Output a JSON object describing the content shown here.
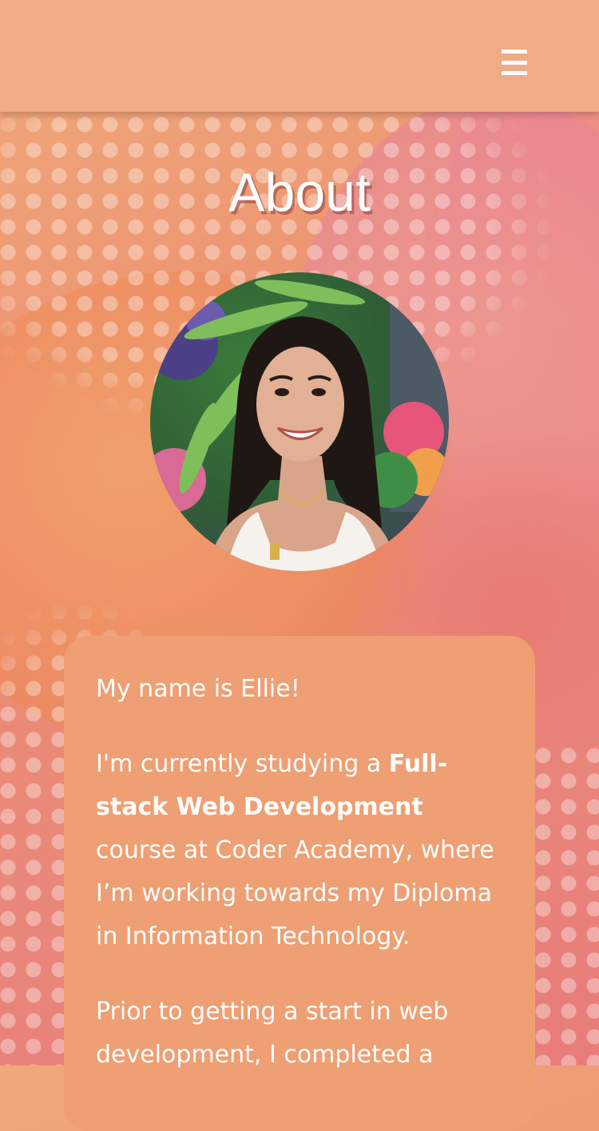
{
  "header": {
    "menu_icon": "hamburger-menu-icon"
  },
  "page": {
    "title": "About"
  },
  "profile": {
    "photo_alt": "Profile photo"
  },
  "about": {
    "p1": "My name is Ellie!",
    "p2_pre": "I'm currently studying a ",
    "p2_bold": "Full-stack Web Development",
    "p2_post": " course at Coder Academy, where I’m working towards my Diploma in Information Technology.",
    "p3": "Prior to getting a start in web development, I completed a"
  },
  "colors": {
    "header_bg": "#efac86",
    "card_bg": "#ee9f73",
    "text": "#ffffff",
    "bg_peach": "#f0a97a",
    "bg_pink": "#e87c7a"
  }
}
